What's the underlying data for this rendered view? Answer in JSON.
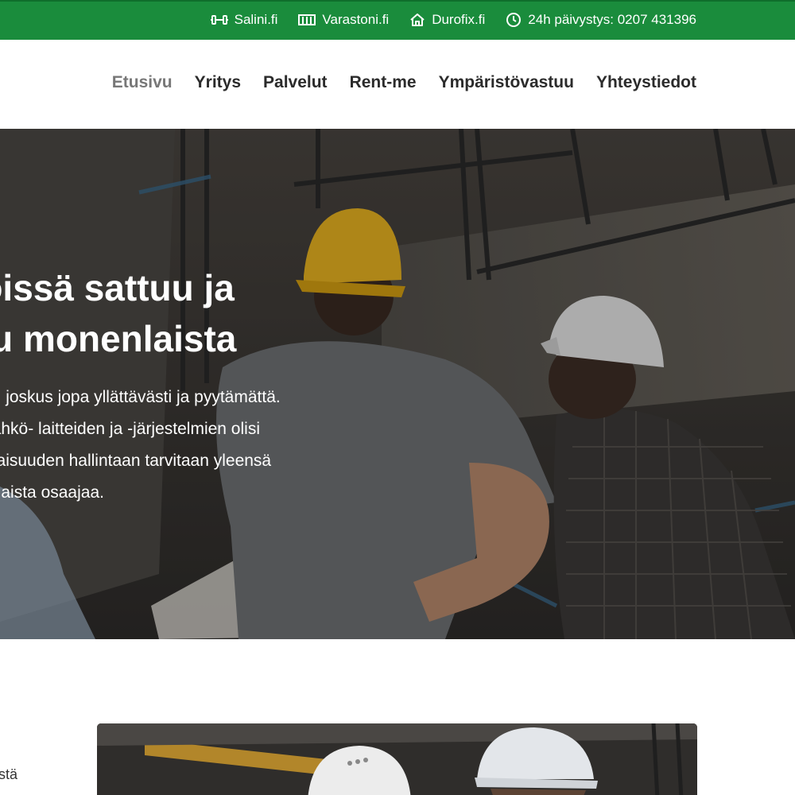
{
  "topbar": {
    "links": [
      {
        "label": "Salini.fi",
        "icon": "dumbbell-icon"
      },
      {
        "label": "Varastoni.fi",
        "icon": "storage-icon"
      },
      {
        "label": "Durofix.fi",
        "icon": "home-icon"
      },
      {
        "label": "24h päivystys: 0207 431396",
        "icon": "clock-icon"
      }
    ],
    "color": "#1a8c3c"
  },
  "nav": {
    "items": [
      {
        "label": "Etusivu",
        "active": true
      },
      {
        "label": "Yritys"
      },
      {
        "label": "Palvelut"
      },
      {
        "label": "Rent-me"
      },
      {
        "label": "Ympäristövastuu"
      },
      {
        "label": "Yhteystiedot"
      }
    ]
  },
  "hero": {
    "title_lines": [
      "töissä sattuu ja",
      "uu monenlaista"
    ],
    "text_lines": [
      "kaan, joskus jopa yllättävästi ja pyytämättä.",
      "ti-, sähkö- laitteiden ja -järjestelmien olisi",
      "okonaisuuden hallintaan tarvitaan yleensä",
      "onenlaista osaajaa."
    ]
  },
  "lower": {
    "side_text": "stä"
  }
}
